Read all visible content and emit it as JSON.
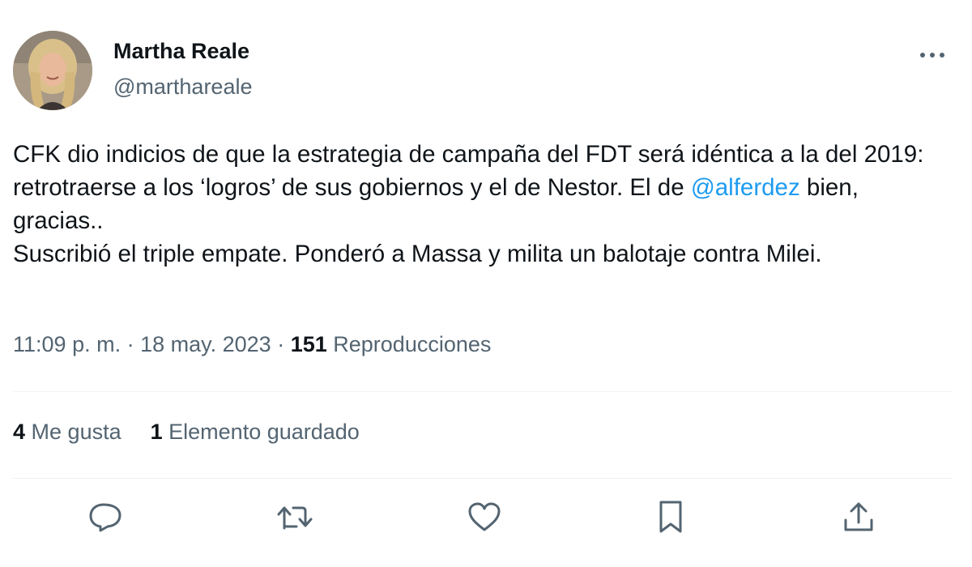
{
  "author": {
    "name": "Martha Reale",
    "handle": "@marthareale"
  },
  "tweet": {
    "line1_text": "CFK dio indicios de que la estrategia de campaña del FDT será idéntica a la del 2019: retrotraerse a los ‘logros’ de sus gobiernos y el de Nestor. El de ",
    "mention": "@alferdez",
    "line1_suffix": " bien, gracias..",
    "line2_text": "Suscribió el triple empate. Ponderó a Massa y milita un balotaje contra Milei."
  },
  "meta": {
    "time": "11:09 p. m.",
    "separator": " · ",
    "date": "18 may. 2023",
    "views_count": "151",
    "views_label": "Reproducciones"
  },
  "stats": {
    "likes_count": "4",
    "likes_label": "Me gusta",
    "bookmarks_count": "1",
    "bookmarks_label": "Elemento guardado"
  },
  "icons": {
    "more": "more-dots-icon",
    "reply": "reply-bubble-icon",
    "retweet": "retweet-arrows-icon",
    "like": "heart-icon",
    "bookmark": "bookmark-icon",
    "share": "share-upload-icon"
  },
  "colors": {
    "text": "#0f1419",
    "secondary": "#536471",
    "link": "#1d9bf0",
    "divider": "#eff3f4"
  }
}
